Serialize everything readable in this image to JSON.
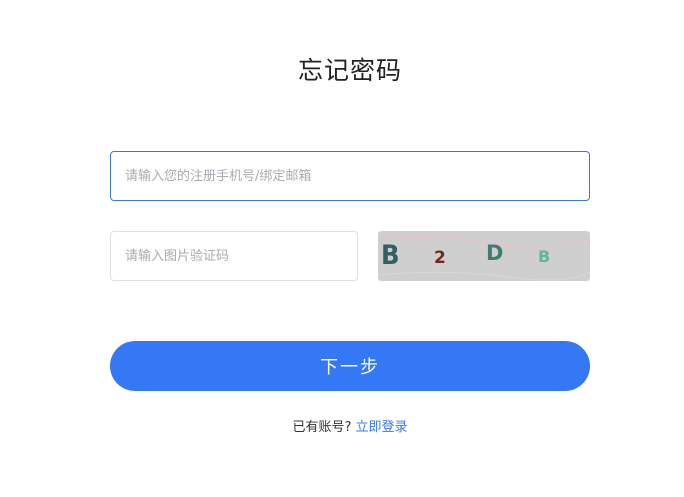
{
  "page": {
    "title": "忘记密码"
  },
  "form": {
    "account_placeholder": "请输入您的注册手机号/绑定邮箱",
    "account_value": "",
    "captcha_placeholder": "请输入图片验证码",
    "captcha_value": "",
    "captcha_image": {
      "characters": [
        "B",
        "2",
        "D",
        "B"
      ]
    },
    "next_label": "下一步"
  },
  "footer": {
    "have_account_text": "已有账号?",
    "login_link_label": "立即登录"
  },
  "colors": {
    "accent": "#3478f6",
    "focused_border": "#3b78e7",
    "captcha_background": "#cfcfcf"
  }
}
